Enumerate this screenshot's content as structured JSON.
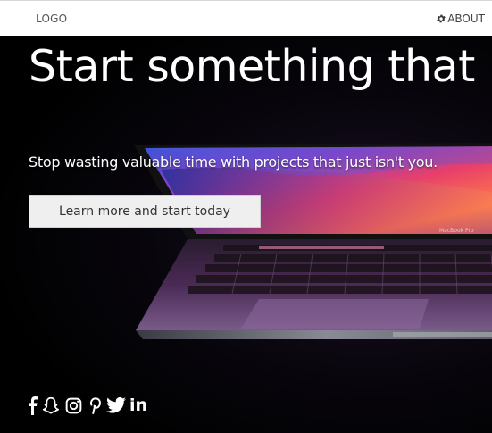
{
  "navbar": {
    "logo": "LOGO",
    "about": {
      "label": "ABOUT",
      "icon": "gear-icon"
    }
  },
  "hero": {
    "title": "Start something that matters",
    "subtitle": "Stop wasting valuable time with projects that just isn't you.",
    "cta_label": "Learn more and start today"
  },
  "laptop": {
    "screen_label": "MacBook Pro"
  },
  "social": [
    {
      "name": "facebook-icon"
    },
    {
      "name": "snapchat-icon"
    },
    {
      "name": "instagram-icon"
    },
    {
      "name": "pinterest-icon"
    },
    {
      "name": "twitter-icon"
    },
    {
      "name": "linkedin-icon",
      "text": "in"
    }
  ],
  "colors": {
    "background": "#000000",
    "navbar": "#ffffff",
    "text": "#ffffff",
    "button": "#efefef"
  }
}
